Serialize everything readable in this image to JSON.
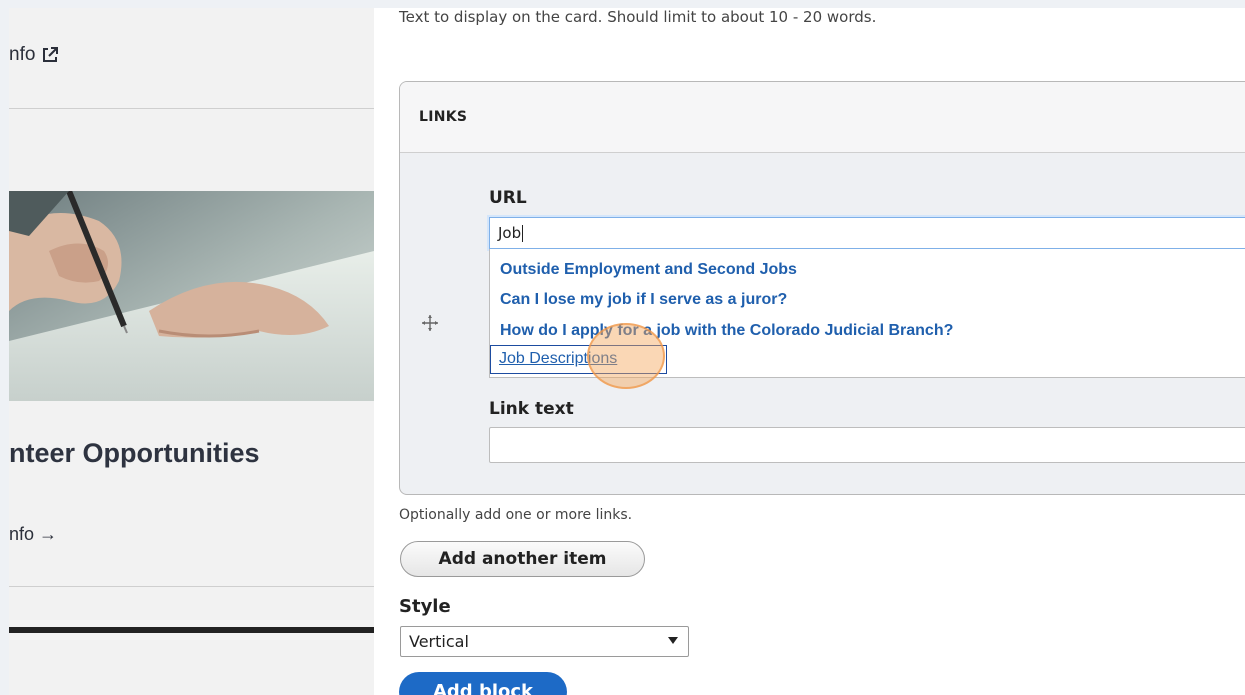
{
  "preview": {
    "more_info_top": "nfo",
    "card_title": "nteer Opportunities",
    "more_info_bottom": "nfo →"
  },
  "form": {
    "text_help": "Text to display on the card. Should limit to about 10 - 20 words.",
    "links_legend": "LINKS",
    "url_label": "URL",
    "url_value": "Job",
    "autocomplete": [
      "Outside Employment and Second Jobs",
      "Can I lose my job if I serve as a juror?",
      "How do I apply for a job with the Colorado Judicial Branch?",
      "Job Descriptions"
    ],
    "link_text_label": "Link text",
    "link_text_value": "",
    "links_help": "Optionally add one or more links.",
    "add_item_button": "Add another item",
    "style_label": "Style",
    "style_value": "Vertical",
    "add_block_button": "Add block"
  },
  "icons": {
    "external_link": "external-link-icon",
    "drag_handle": "move-icon",
    "select_arrow": "chevron-down-icon"
  },
  "colors": {
    "link_blue": "#1f5fad",
    "primary_button": "#1d6ac6",
    "click_highlight": "#f5a65a"
  }
}
